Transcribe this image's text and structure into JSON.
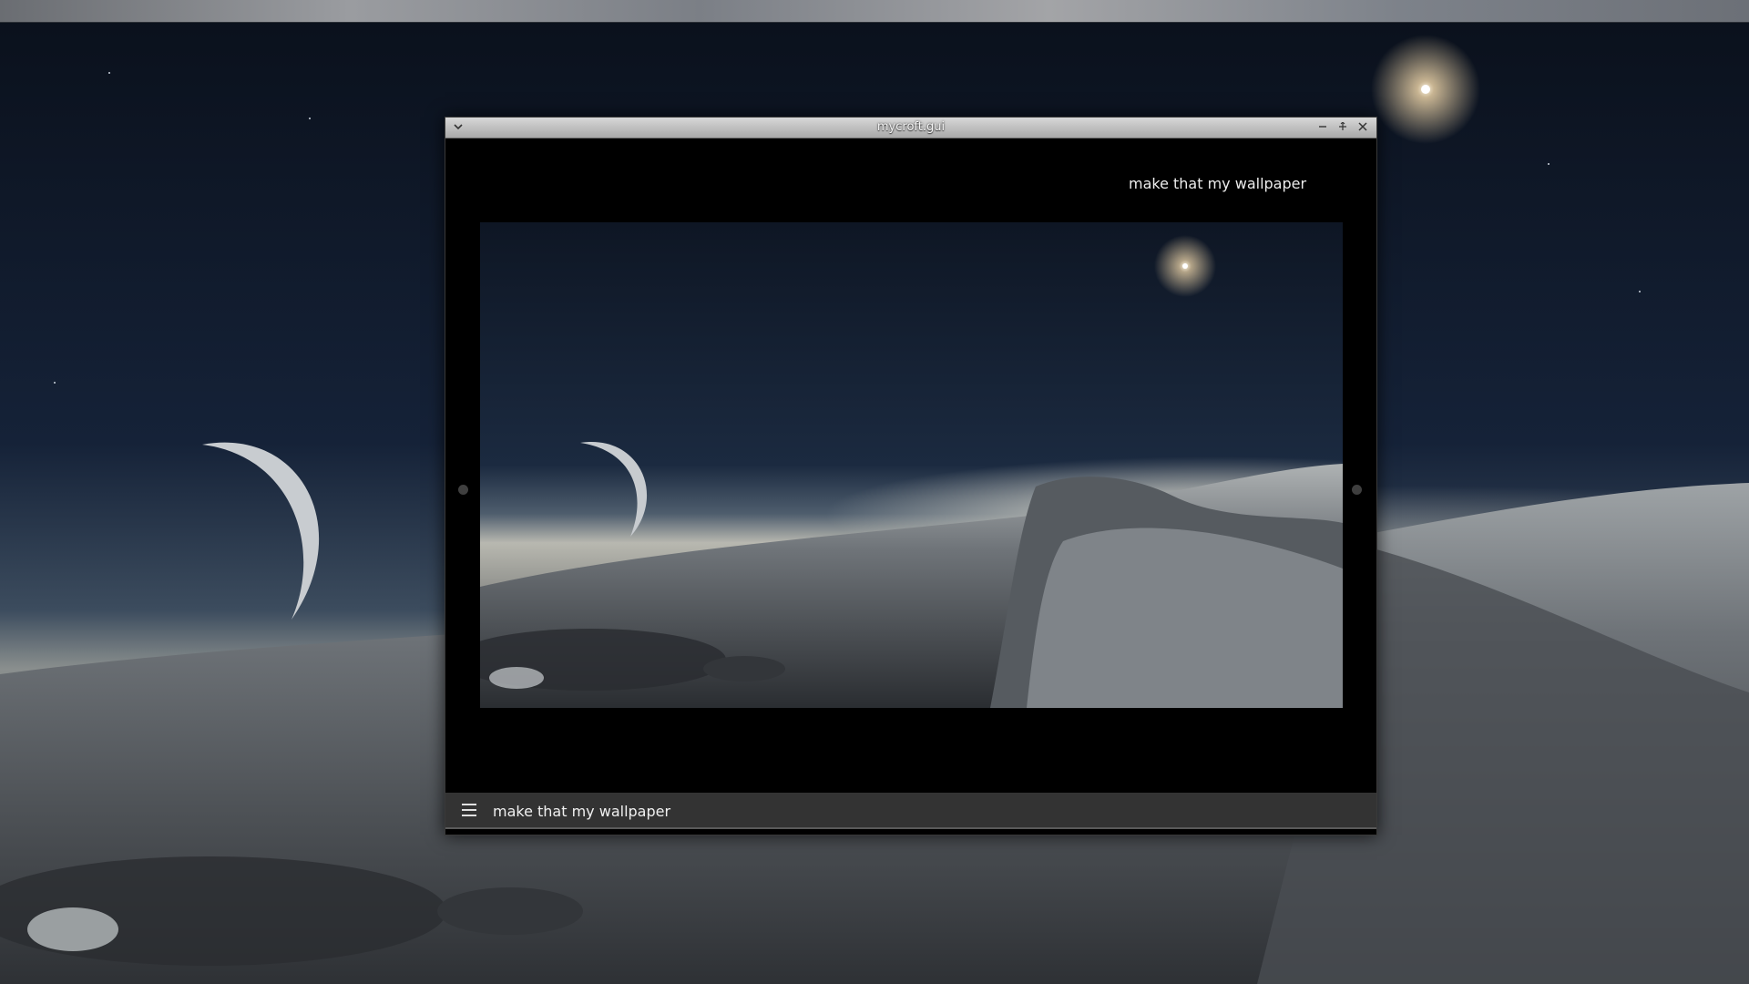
{
  "window": {
    "title": "mycroft.gui",
    "menu_icon": "chevron-down-icon",
    "controls": {
      "minimize_icon": "minimize-icon",
      "maximize_icon": "maximize-icon",
      "close_icon": "close-icon"
    }
  },
  "conversation": {
    "utterance": "make that my wallpaper"
  },
  "input": {
    "menu_icon": "hamburger-icon",
    "value": "make that my wallpaper"
  },
  "colors": {
    "window_background": "#000000",
    "bottom_bar": "#333333",
    "text": "#ececec"
  }
}
